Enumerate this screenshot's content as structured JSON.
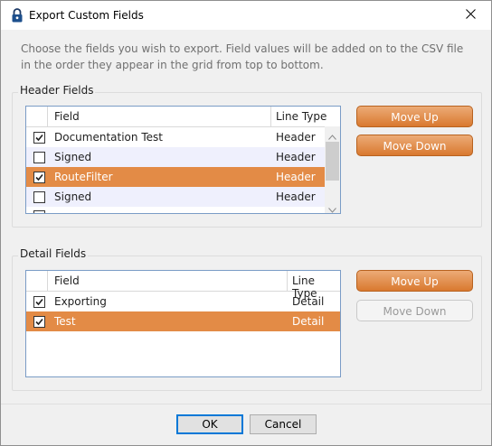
{
  "window": {
    "title": "Export Custom Fields"
  },
  "instructions": "Choose the fields you wish to export. Field values will be added on to the CSV file in the order they appear in the grid from top to bottom.",
  "header_fields": {
    "group_label": "Header Fields",
    "columns": {
      "field": "Field",
      "line_type": "Line Type"
    },
    "rows": [
      {
        "field": "Documentation Test",
        "line_type": "Header",
        "checked": true,
        "selected": false
      },
      {
        "field": "Signed",
        "line_type": "Header",
        "checked": false,
        "selected": false
      },
      {
        "field": "RouteFilter",
        "line_type": "Header",
        "checked": true,
        "selected": true
      },
      {
        "field": "Signed",
        "line_type": "Header",
        "checked": false,
        "selected": false
      }
    ],
    "move_up_label": "Move Up",
    "move_down_label": "Move Down"
  },
  "detail_fields": {
    "group_label": "Detail Fields",
    "columns": {
      "field": "Field",
      "line_type": "Line Type"
    },
    "rows": [
      {
        "field": "Exporting",
        "line_type": "Detail",
        "checked": true,
        "selected": false
      },
      {
        "field": "Test",
        "line_type": "Detail",
        "checked": true,
        "selected": true
      }
    ],
    "move_up_label": "Move Up",
    "move_down_label": "Move Down"
  },
  "footer": {
    "ok_label": "OK",
    "cancel_label": "Cancel"
  },
  "colors": {
    "selected_row": "#e38b46",
    "alt_row": "#eff0fd",
    "accent_button": "#d9792f",
    "grid_border": "#7a9cc6"
  }
}
